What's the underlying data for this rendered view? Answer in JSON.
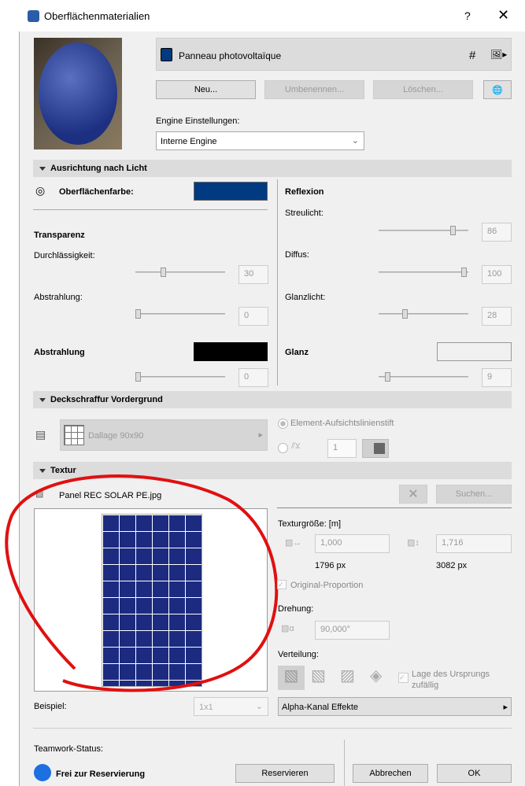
{
  "title": "Oberflächenmaterialien",
  "help": "?",
  "material_name": "Panneau photovoltaïque",
  "material_color": "#003a80",
  "buttons": {
    "new": "Neu...",
    "rename": "Umbenennen...",
    "delete": "Löschen...",
    "search": "Suchen...",
    "reserve": "Reservieren",
    "cancel": "Abbrechen",
    "ok": "OK"
  },
  "engine_label": "Engine Einstellungen:",
  "engine_value": "Interne Engine",
  "sec_light": "Ausrichtung nach Licht",
  "surface_color_label": "Oberflächenfarbe:",
  "transparency": {
    "title": "Transparenz",
    "permeability_label": "Durchlässigkeit:",
    "permeability": "30",
    "emission_label": "Abstrahlung:",
    "emission": "0"
  },
  "reflection": {
    "title": "Reflexion",
    "ambient_label": "Streulicht:",
    "ambient": "86",
    "diffuse_label": "Diffus:",
    "diffuse": "100",
    "specular_label": "Glanzlicht:",
    "specular": "28"
  },
  "emission": {
    "title": "Abstrahlung",
    "value": "0"
  },
  "gloss": {
    "title": "Glanz",
    "value": "9"
  },
  "sec_hatch": "Deckschraffur Vordergrund",
  "hatch_name": "Dallage 90x90",
  "pen_option": "Element-Aufsichtslinienstift",
  "pen_value": "1",
  "sec_texture": "Textur",
  "texture_file": "Panel REC SOLAR PE.jpg",
  "texture_size_label": "Texturgröße: [m]",
  "width_value": "1,000",
  "height_value": "1,716",
  "width_px": "1796 px",
  "height_px": "3082 px",
  "original_proportion": "Original-Proportion",
  "rotation_label": "Drehung:",
  "rotation_value": "90,000°",
  "distribution_label": "Verteilung:",
  "random_origin": "Lage des Ursprungs zufällig",
  "example_label": "Beispiel:",
  "example_value": "1x1",
  "alpha_label": "Alpha-Kanal Effekte",
  "teamwork_label": "Teamwork-Status:",
  "teamwork_status": "Frei zur Reservierung"
}
